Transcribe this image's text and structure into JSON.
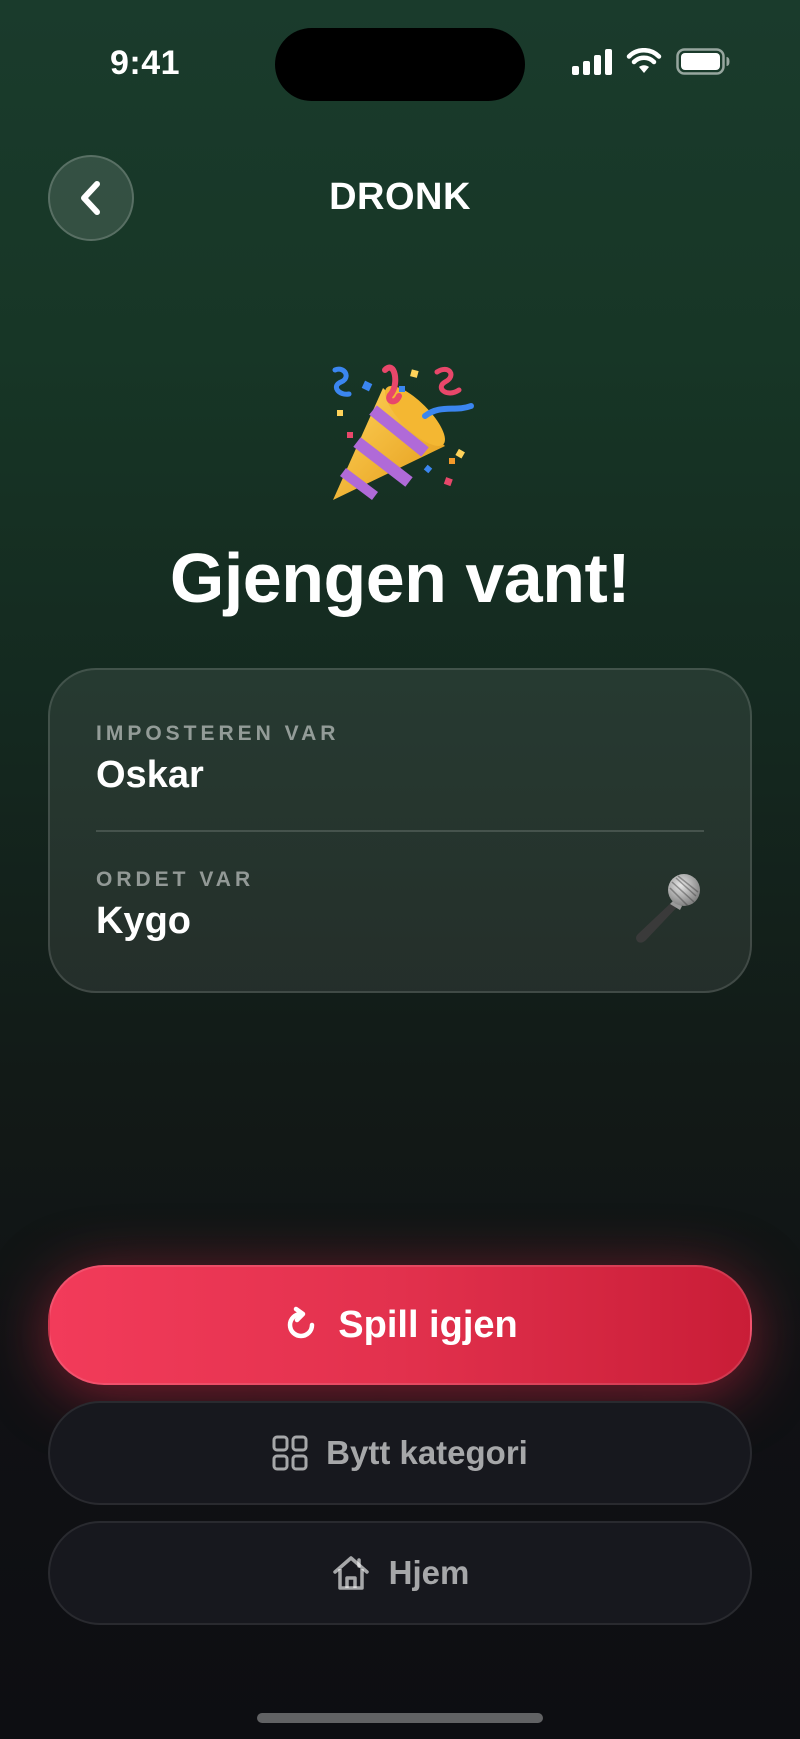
{
  "status_bar": {
    "time": "9:41"
  },
  "header": {
    "title": "DRONK",
    "back_icon": "chevron-left-icon"
  },
  "result": {
    "icon": "party-popper-icon",
    "title": "Gjengen vant!"
  },
  "card": {
    "imposter_label": "IMPOSTEREN VAR",
    "imposter_name": "Oskar",
    "word_label": "ORDET VAR",
    "word": "Kygo",
    "word_icon": "microphone-icon"
  },
  "actions": {
    "play_again": "Spill igjen",
    "change_category": "Bytt kategori",
    "home": "Hjem"
  },
  "colors": {
    "accent": "#e2314d",
    "background_top": "#1a3b2c",
    "background_bottom": "#0d0e12"
  }
}
